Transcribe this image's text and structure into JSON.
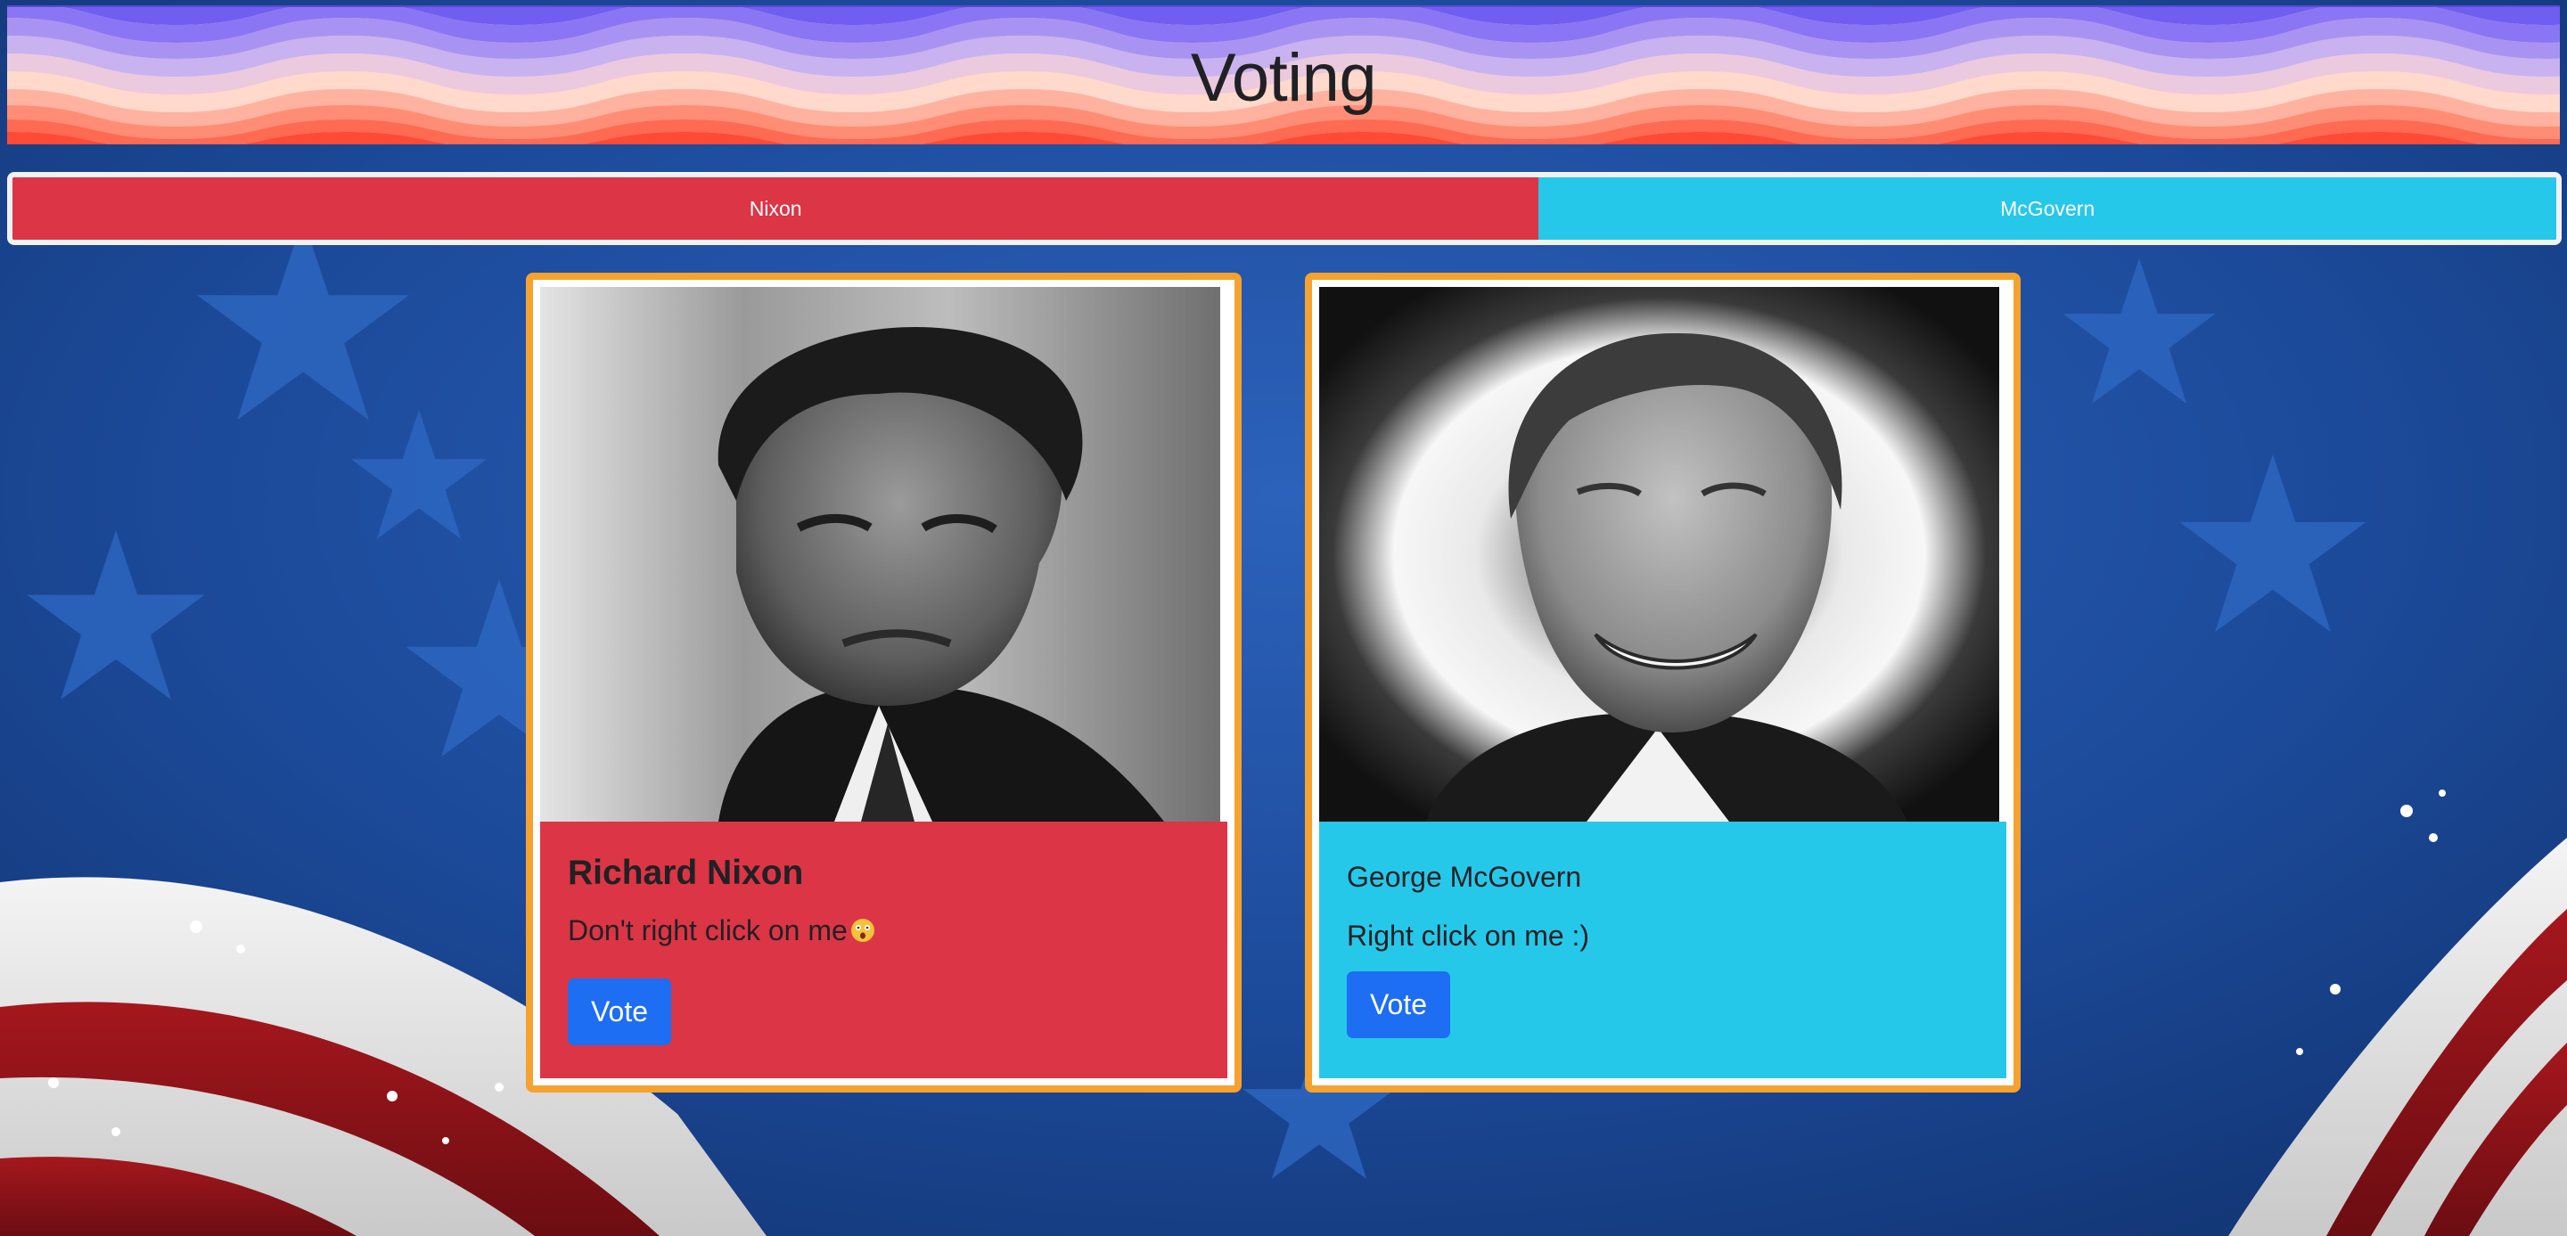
{
  "header": {
    "title": "Voting"
  },
  "tally": {
    "nixon_label": "Nixon",
    "mcgovern_label": "McGovern",
    "nixon_share": 0.6,
    "colors": {
      "nixon": "#dc3545",
      "mcgovern": "#26c8ea"
    }
  },
  "candidates": [
    {
      "name": "Richard Nixon",
      "message": "Don't right click on me",
      "message_emoji": "astonished-face-icon",
      "button_label": "Vote",
      "color": "#dc3545"
    },
    {
      "name": "George McGovern",
      "message": "Right click on me :)",
      "button_label": "Vote",
      "color": "#26c8ea"
    }
  ],
  "theme": {
    "card_border": "#f6a22e",
    "button": "#1d6ef2"
  }
}
